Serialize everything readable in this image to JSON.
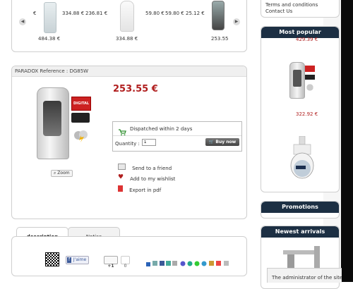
{
  "carousel": {
    "euro_symbol": "€",
    "top_prices": [
      "334.88 €",
      "236.81 €",
      "59.80 €",
      "59.80 €",
      "25.12 €"
    ],
    "bottom_prices": [
      "484.38 €",
      "334.88 €",
      "253.55"
    ]
  },
  "product": {
    "reference_label": "PARADOX Reference : DG85W",
    "price": "253.55 €",
    "zoom_label": "Zoom",
    "dispatch_text": "Dispatched within 2 days",
    "quantity_label": "Quantity :",
    "quantity_value": "1",
    "buy_label": "Buy now",
    "links": {
      "send": "Send to a friend",
      "wishlist": "Add to my wishlist",
      "pdf": "Export in pdf"
    },
    "brand_badge": "DIGITAL"
  },
  "tabs": [
    {
      "label": "description"
    },
    {
      "label": "Notice"
    }
  ],
  "social": {
    "facebook_label": "J'aime",
    "plusone_label": "+1",
    "plusone_count": "0"
  },
  "sidebar": {
    "links": [
      "Terms and conditions",
      "Contact Us"
    ],
    "most_popular_title": "Most popular",
    "popular_price_top": "429.39 €",
    "popular_price": "322.92 €",
    "promotions_title": "Promotions",
    "newest_title": "Newest arrivals"
  },
  "notice": {
    "text": "The administrator of the site is ou"
  },
  "colors": {
    "price_red": "#b01e1e",
    "header_dark": "#1c2f43",
    "dispatch_green": "#2f8f2f"
  }
}
